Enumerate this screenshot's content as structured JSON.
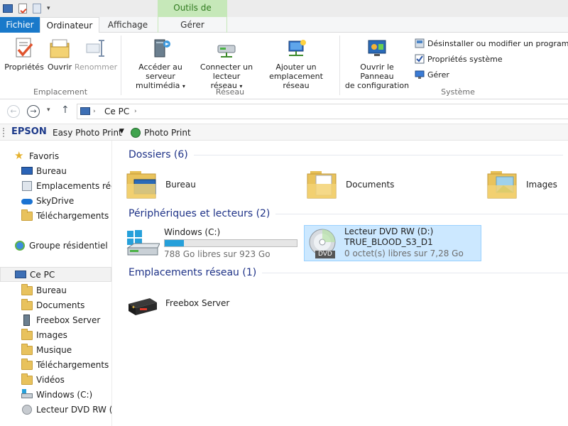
{
  "titlebar": {
    "contextual_group": "Outils de lecteur"
  },
  "tabs": {
    "file": "Fichier",
    "computer": "Ordinateur",
    "view": "Affichage",
    "manage": "Gérer"
  },
  "ribbon": {
    "location": {
      "label": "Emplacement",
      "properties": "Propriétés",
      "open": "Ouvrir",
      "rename": "Renommer"
    },
    "network": {
      "label": "Réseau",
      "media_line1": "Accéder au serveur",
      "media_line2": "multimédia",
      "map_line1": "Connecter un",
      "map_line2": "lecteur réseau",
      "add_line1": "Ajouter un",
      "add_line2": "emplacement réseau"
    },
    "system": {
      "label": "Système",
      "control_line1": "Ouvrir le Panneau",
      "control_line2": "de configuration",
      "uninstall": "Désinstaller ou modifier un programme",
      "sysprops": "Propriétés système",
      "manage": "Gérer"
    }
  },
  "address": {
    "location": "Ce PC"
  },
  "toolbar": {
    "brand": "EPSON",
    "easy_photo": "Easy Photo Print",
    "photo_print": "Photo Print"
  },
  "nav": {
    "favorites": "Favoris",
    "fav_desktop": "Bureau",
    "fav_recent": "Emplacements récer",
    "fav_skydrive": "SkyDrive",
    "fav_downloads": "Téléchargements",
    "homegroup": "Groupe résidentiel",
    "thispc": "Ce PC",
    "pc_desktop": "Bureau",
    "pc_documents": "Documents",
    "pc_freebox": "Freebox Server",
    "pc_images": "Images",
    "pc_music": "Musique",
    "pc_downloads": "Téléchargements",
    "pc_videos": "Vidéos",
    "pc_windows": "Windows (C:)",
    "pc_dvd": "Lecteur DVD RW (D:)"
  },
  "content": {
    "folders_header": "Dossiers (6)",
    "folder_desktop": "Bureau",
    "folder_documents": "Documents",
    "folder_images": "Images",
    "devices_header": "Périphériques et lecteurs (2)",
    "drive_c_name": "Windows (C:)",
    "drive_c_free": "788 Go libres sur 923 Go",
    "drive_c_used_fraction": 0.146,
    "dvd_name": "Lecteur DVD RW (D:)",
    "dvd_label": "TRUE_BLOOD_S3_D1",
    "dvd_free": "0 octet(s) libres sur 7,28 Go",
    "dvd_badge": "DVD",
    "network_header": "Emplacements réseau (1)",
    "freebox": "Freebox Server"
  },
  "colors": {
    "accent": "#1979ca",
    "header_text": "#1e3287",
    "selection": "#cce8ff",
    "contextual": "#c6e8b9"
  }
}
